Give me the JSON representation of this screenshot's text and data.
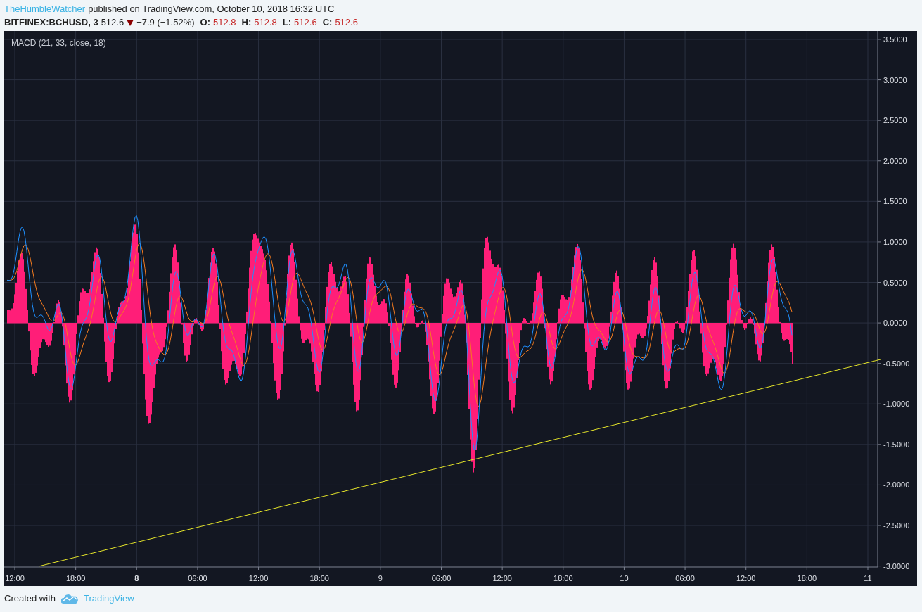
{
  "header": {
    "author": "TheHumbleWatcher",
    "published": "published on TradingView.com, October 10, 2018 16:32 UTC",
    "symbol": "BITFINEX:BCHUSD, 3",
    "price": "512.6",
    "falling": true,
    "change": "−7.9 (−1.52%)",
    "ohlc": [
      {
        "label": "O:",
        "value": "512.8"
      },
      {
        "label": "H:",
        "value": "512.8"
      },
      {
        "label": "L:",
        "value": "512.6"
      },
      {
        "label": "C:",
        "value": "512.6"
      }
    ]
  },
  "chart": {
    "indicator": "MACD (21, 33, close, 18)",
    "y_ticks": [
      "3.5000",
      "3.0000",
      "2.5000",
      "2.0000",
      "1.5000",
      "1.0000",
      "0.5000",
      "0.0000",
      "-0.5000",
      "-1.0000",
      "-1.5000",
      "-2.0000",
      "-2.5000",
      "-3.0000"
    ],
    "x_ticks": [
      {
        "label": "12:00",
        "bold": false
      },
      {
        "label": "18:00",
        "bold": false
      },
      {
        "label": "8",
        "bold": true
      },
      {
        "label": "06:00",
        "bold": false
      },
      {
        "label": "12:00",
        "bold": false
      },
      {
        "label": "18:00",
        "bold": false
      },
      {
        "label": "9",
        "bold": false
      },
      {
        "label": "06:00",
        "bold": false
      },
      {
        "label": "12:00",
        "bold": false
      },
      {
        "label": "18:00",
        "bold": false
      },
      {
        "label": "10",
        "bold": false
      },
      {
        "label": "06:00",
        "bold": false
      },
      {
        "label": "12:00",
        "bold": false
      },
      {
        "label": "18:00",
        "bold": false
      },
      {
        "label": "11",
        "bold": false
      }
    ]
  },
  "footer": {
    "text": "Created with",
    "link": "TradingView"
  }
}
